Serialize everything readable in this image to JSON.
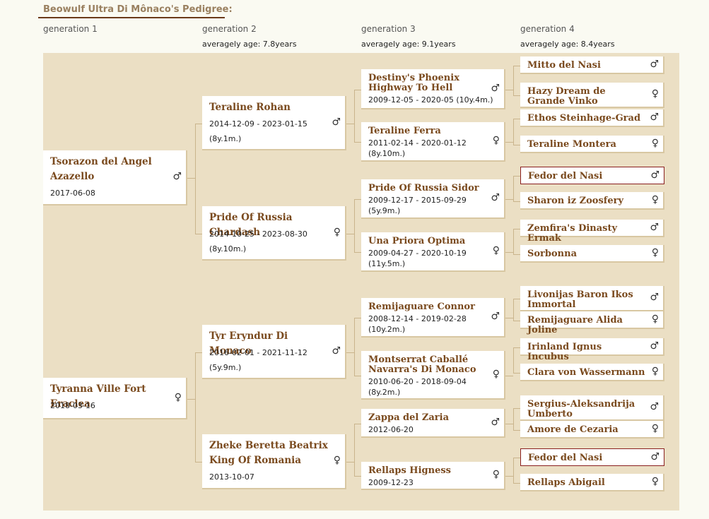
{
  "title": "Beowulf Ultra Di Mônaco's Pedigree:",
  "generations": [
    {
      "label": "generation 1",
      "avg": ""
    },
    {
      "label": "generation 2",
      "avg": "averagely age: 7.8years"
    },
    {
      "label": "generation 3",
      "avg": "averagely age: 9.1years"
    },
    {
      "label": "generation 4",
      "avg": "averagely age: 8.4years"
    }
  ],
  "g1": [
    {
      "name": "Tsorazon del Angel Azazello",
      "date": "2017-06-08",
      "sex": "♂"
    },
    {
      "name": "Tyranna Ville Fort Eraclea",
      "date": "2018-03-16",
      "sex": "♀"
    }
  ],
  "g2": [
    {
      "name": "Teraline Rohan",
      "date": "2014-12-09 - 2023-01-15",
      "age": "(8y.1m.)",
      "sex": "♂"
    },
    {
      "name": "Pride Of Russia Chardash",
      "date": "2014-10-25 - 2023-08-30",
      "age": "(8y.10m.)",
      "sex": "♀"
    },
    {
      "name": "Tyr Eryndur Di Monaco",
      "date": "2016-02-01 - 2021-11-12",
      "age": "(5y.9m.)",
      "sex": "♂"
    },
    {
      "name": "Zheke Beretta Beatrix King Of Romania",
      "date": "2013-10-07",
      "age": "",
      "sex": "♀"
    }
  ],
  "g3": [
    {
      "name": "Destiny's Phoenix Highway To Hell",
      "date": "2009-12-05 - 2020-05 (10y.4m.)",
      "age": "",
      "sex": "♂"
    },
    {
      "name": "Teraline Ferra",
      "date": "2011-02-14 - 2020-01-12",
      "age": "(8y.10m.)",
      "sex": "♀"
    },
    {
      "name": "Pride Of Russia Sidor",
      "date": "2009-12-17 - 2015-09-29",
      "age": "(5y.9m.)",
      "sex": "♂"
    },
    {
      "name": "Una Priora Optima",
      "date": "2009-04-27 - 2020-10-19",
      "age": "(11y.5m.)",
      "sex": "♀"
    },
    {
      "name": "Remijaguare Connor",
      "date": "2008-12-14 - 2019-02-28",
      "age": "(10y.2m.)",
      "sex": "♂"
    },
    {
      "name": "Montserrat Caballé Navarra's Di Monaco",
      "date": "2010-06-20 - 2018-09-04",
      "age": "(8y.2m.)",
      "sex": "♀"
    },
    {
      "name": "Zappa del Zaria",
      "date": "2012-06-20",
      "age": "",
      "sex": "♂"
    },
    {
      "name": "Rellaps Higness",
      "date": "2009-12-23",
      "age": "",
      "sex": "♀"
    }
  ],
  "g4": [
    {
      "name": "Mitto del Nasi",
      "sex": "♂"
    },
    {
      "name": "Hazy Dream de Grande Vinko",
      "sex": "♀"
    },
    {
      "name": "Ethos Steinhage-Grad",
      "sex": "♂"
    },
    {
      "name": "Teraline Montera",
      "sex": "♀"
    },
    {
      "name": "Fedor del Nasi",
      "sex": "♂"
    },
    {
      "name": "Sharon iz Zoosfery",
      "sex": "♀"
    },
    {
      "name": "Zemfira's Dinasty Ermak",
      "sex": "♂"
    },
    {
      "name": "Sorbonna",
      "sex": "♀"
    },
    {
      "name": "Livonijas Baron Ikos Immortal",
      "sex": "♂"
    },
    {
      "name": "Remijaguare Alida Joline",
      "sex": "♀"
    },
    {
      "name": "Irinland Ignus Incubus",
      "sex": "♂"
    },
    {
      "name": "Clara von Wassermann",
      "sex": "♀"
    },
    {
      "name": "Sergius-Aleksandrija Umberto",
      "sex": "♂"
    },
    {
      "name": "Amore de Cezaria",
      "sex": "♀"
    },
    {
      "name": "Fedor del Nasi",
      "sex": "♂"
    },
    {
      "name": "Rellaps Abigail",
      "sex": "♀"
    }
  ]
}
